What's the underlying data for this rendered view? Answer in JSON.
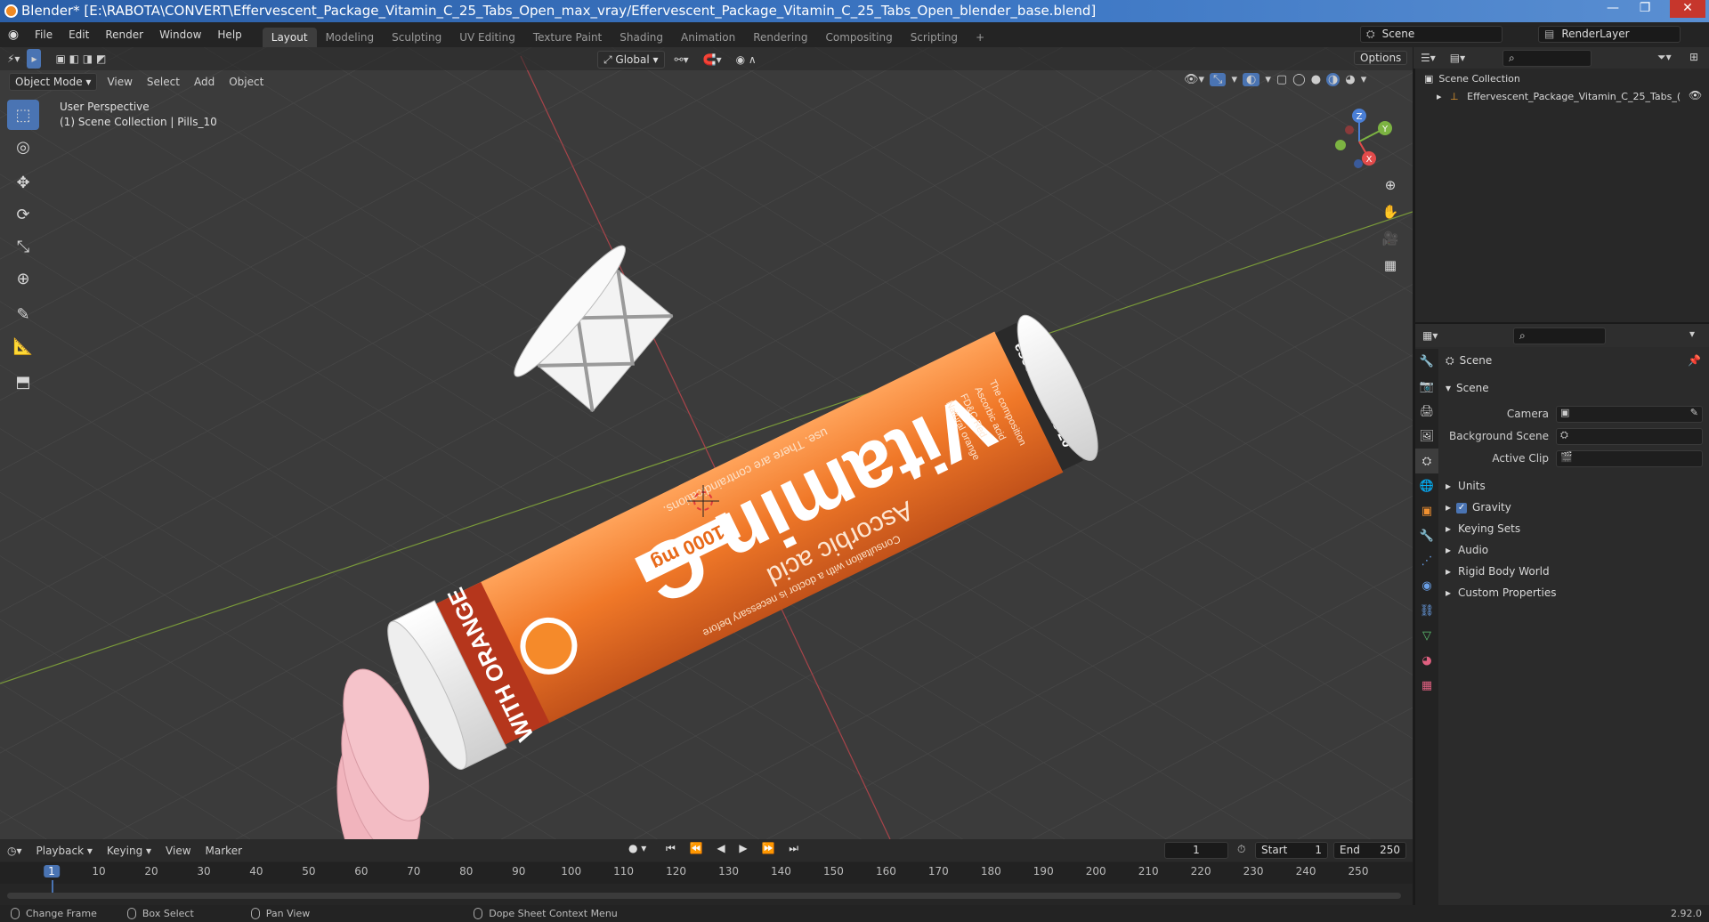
{
  "title_bar": {
    "text": "Blender* [E:\\RABOTA\\CONVERT\\Effervescent_Package_Vitamin_C_25_Tabs_Open_max_vray/Effervescent_Package_Vitamin_C_25_Tabs_Open_blender_base.blend]"
  },
  "menu": [
    "File",
    "Edit",
    "Render",
    "Window",
    "Help"
  ],
  "workspaces": [
    "Layout",
    "Modeling",
    "Sculpting",
    "UV Editing",
    "Texture Paint",
    "Shading",
    "Animation",
    "Rendering",
    "Compositing",
    "Scripting"
  ],
  "active_workspace": "Layout",
  "scene_field": "Scene",
  "renderlayer_field": "RenderLayer",
  "viewport_header": {
    "mode": "Object Mode",
    "menus": [
      "View",
      "Select",
      "Add",
      "Object"
    ],
    "orientation": "Global",
    "options": "Options"
  },
  "viewport_info": {
    "line1": "User Perspective",
    "line2": "(1) Scene Collection | Pills_10"
  },
  "gizmo_axes": {
    "z": "Z",
    "y": "Y",
    "x": "X"
  },
  "product": {
    "brand": "Vitamin C",
    "subtitle": "Ascorbic acid",
    "dose": "1000 mg",
    "flavor": "WITH ORANGE",
    "end_band": "escent tablets 20",
    "side_text_1": "The composition",
    "side_text_2": "Ascorbic acid",
    "side_text_3": "FD&C Red",
    "side_text_4": "Natural orange",
    "body_text": "use. There are contraindications.",
    "body_text_2": "Consultation with a doctor is necessary before"
  },
  "timeline": {
    "menus": [
      "Playback",
      "Keying",
      "View",
      "Marker"
    ],
    "current_frame": "1",
    "start_label": "Start",
    "start": "1",
    "end_label": "End",
    "end": "250",
    "ticks": [
      "1",
      "10",
      "20",
      "30",
      "40",
      "50",
      "60",
      "70",
      "80",
      "90",
      "100",
      "110",
      "120",
      "130",
      "140",
      "150",
      "160",
      "170",
      "180",
      "190",
      "200",
      "210",
      "220",
      "230",
      "240",
      "250"
    ]
  },
  "status_bar": {
    "items": [
      "Change Frame",
      "Box Select",
      "Pan View",
      "Dope Sheet Context Menu"
    ],
    "version": "2.92.0"
  },
  "outliner": {
    "root": "Scene Collection",
    "child": "Effervescent_Package_Vitamin_C_25_Tabs_("
  },
  "properties": {
    "context": "Scene",
    "panel": "Scene",
    "camera_label": "Camera",
    "background_label": "Background Scene",
    "clip_label": "Active Clip",
    "sections": [
      "Units",
      "Gravity",
      "Keying Sets",
      "Audio",
      "Rigid Body World",
      "Custom Properties"
    ],
    "gravity_checked": true
  }
}
